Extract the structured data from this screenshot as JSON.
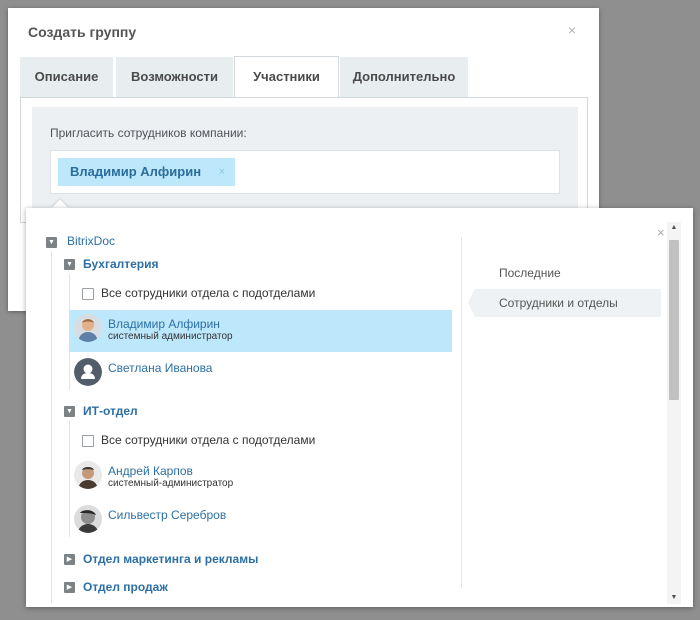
{
  "dialog": {
    "title": "Создать группу",
    "close_glyph": "×",
    "tabs": [
      {
        "label": "Описание"
      },
      {
        "label": "Возможности"
      },
      {
        "label": "Участники"
      },
      {
        "label": "Дополнительно"
      }
    ],
    "active_tab": "Участники",
    "invite_label": "Пригласить сотрудников компании:",
    "selected_token": {
      "name": "Владимир Алфирин",
      "remove_glyph": "×"
    }
  },
  "selector": {
    "close_glyph": "×",
    "root": {
      "label": "BitrixDoc",
      "expanded": true
    },
    "departments": [
      {
        "label": "Бухгалтерия",
        "expanded": true,
        "all_employees_label": "Все сотрудники отдела с подотделами",
        "users": [
          {
            "name": "Владимир Алфирин",
            "position": "системный администратор",
            "selected": true,
            "avatar": "photo-avatar"
          },
          {
            "name": "Светлана Иванова",
            "position": "",
            "selected": false,
            "avatar": "default-user-avatar"
          }
        ]
      },
      {
        "label": "ИТ-отдел",
        "expanded": true,
        "all_employees_label": "Все сотрудники отдела с подотделами",
        "users": [
          {
            "name": "Андрей Карпов",
            "position": "системный-администратор",
            "selected": false,
            "avatar": "photo-avatar"
          },
          {
            "name": "Сильвестр Серебров",
            "position": "",
            "selected": false,
            "avatar": "photo-avatar"
          }
        ]
      },
      {
        "label": "Отдел маркетинга и рекламы",
        "expanded": false
      },
      {
        "label": "Отдел продаж",
        "expanded": false
      }
    ],
    "side_tabs": [
      {
        "label": "Последние",
        "active": false
      },
      {
        "label": "Сотрудники и отделы",
        "active": true
      }
    ]
  },
  "colors": {
    "accent_link": "#2d6fa3",
    "selection_bg": "#bde8fb",
    "overlay": "#8f8f8f"
  }
}
